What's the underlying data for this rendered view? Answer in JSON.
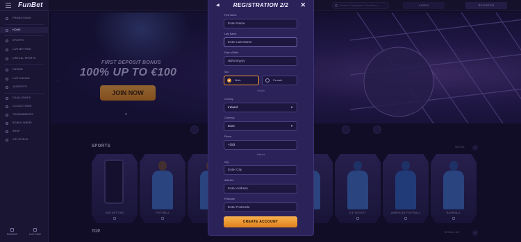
{
  "header": {
    "logo": "FunBet",
    "search_placeholder": "Search: Categories, Providers",
    "login_label": "LOGIN",
    "register_label": "REGISTER"
  },
  "sidebar": {
    "items": [
      {
        "label": "PROMOTIONS",
        "active": false
      },
      {
        "label": "HOME",
        "active": true
      },
      {
        "label": "SPORTS",
        "active": false
      },
      {
        "label": "LIVE BETTING",
        "active": false
      },
      {
        "label": "VIRTUAL SPORTS",
        "active": false
      },
      {
        "label": "CASINO",
        "active": false
      },
      {
        "label": "LIVE CASINO",
        "active": false
      },
      {
        "label": "JACKPOTS",
        "active": false
      },
      {
        "label": "CHALLENGES",
        "active": false
      },
      {
        "label": "COLLECTIONS",
        "active": false
      },
      {
        "label": "TOURNAMENTS",
        "active": false
      },
      {
        "label": "BONUS WHEEL",
        "active": false
      },
      {
        "label": "SHOP",
        "active": false
      },
      {
        "label": "VIP LEVELS",
        "active": false
      }
    ],
    "bottom": [
      {
        "label": "RANKING"
      },
      {
        "label": "LIVE CHAT"
      }
    ]
  },
  "hero": {
    "subtitle": "FIRST DEPOSIT BONUS",
    "title": "100% UP TO €100",
    "cta": "JOIN NOW"
  },
  "sections": {
    "sports_title": "SPORTS",
    "top_title": "TOP",
    "see_all": "SEE ALL",
    "see_all_2": "SEE ALL 120"
  },
  "sport_cards": [
    {
      "label": "ODD BETTING"
    },
    {
      "label": "FOOTBALL"
    },
    {
      "label": ""
    },
    {
      "label": ""
    },
    {
      "label": "ICE HOCKEY"
    },
    {
      "label": "AMERICAN FOOTBALL"
    },
    {
      "label": "BASEBALL"
    }
  ],
  "modal": {
    "title": "REGISTRATION 2/2",
    "fields": {
      "first_name_label": "First Name",
      "first_name_placeholder": "Enter Name",
      "last_name_label": "Last Name",
      "last_name_placeholder": "Enter Last Name",
      "dob_label": "Date of Birth",
      "dob_placeholder": "dd/mm/yyyy",
      "sex_label": "Sex",
      "male_label": "Male",
      "female_label": "Female",
      "sex_hint": "Gender",
      "country_label": "Country",
      "country_value": "Ireland",
      "currency_label": "Currency",
      "currency_value": "Euro",
      "phone_label": "Phone",
      "phone_value": "+353",
      "phone_hint": "Address",
      "city_label": "City",
      "city_placeholder": "Enter City",
      "address_label": "Address",
      "address_placeholder": "Enter Address",
      "postcode_label": "Postcode",
      "postcode_placeholder": "Enter Postcode"
    },
    "submit_label": "CREATE ACCOUNT"
  },
  "colors": {
    "accent": "#f09a34",
    "background": "#15112b",
    "modal": "#2c225a"
  }
}
